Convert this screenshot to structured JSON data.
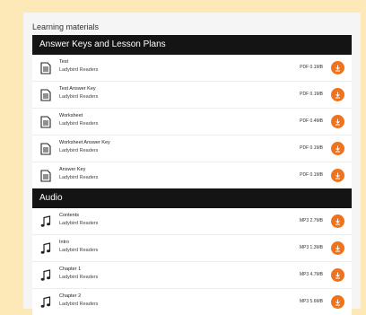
{
  "heading": "Learning materials",
  "keys_section": {
    "title": "Answer Keys and Lesson Plans",
    "items": [
      {
        "title": "Test",
        "subtitle": "Ladybird Readers",
        "meta": "PDF 0.1MB",
        "icon": "document-icon"
      },
      {
        "title": "Test Answer Key",
        "subtitle": "Ladybird Readers",
        "meta": "PDF 0.1MB",
        "icon": "document-icon"
      },
      {
        "title": "Worksheet",
        "subtitle": "Ladybird Readers",
        "meta": "PDF 0.4MB",
        "icon": "document-icon"
      },
      {
        "title": "Worksheet Answer Key",
        "subtitle": "Ladybird Readers",
        "meta": "PDF 0.1MB",
        "icon": "document-icon"
      },
      {
        "title": "Answer Key",
        "subtitle": "Ladybird Readers",
        "meta": "PDF 0.1MB",
        "icon": "document-icon"
      }
    ]
  },
  "audio_section": {
    "title": "Audio",
    "items": [
      {
        "title": "Contents",
        "subtitle": "Ladybird Readers",
        "meta": "MP3 2.7MB",
        "icon": "music-note-icon"
      },
      {
        "title": "Intro",
        "subtitle": "Ladybird Readers",
        "meta": "MP3 1.3MB",
        "icon": "music-note-icon"
      },
      {
        "title": "Chapter 1",
        "subtitle": "Ladybird Readers",
        "meta": "MP3 4.7MB",
        "icon": "music-note-icon"
      },
      {
        "title": "Chapter 2",
        "subtitle": "Ladybird Readers",
        "meta": "MP3 5.6MB",
        "icon": "music-note-icon"
      }
    ]
  },
  "colors": {
    "page_background": "#fde9b7",
    "header_bar": "#141414",
    "download_accent": "#f0731c"
  }
}
